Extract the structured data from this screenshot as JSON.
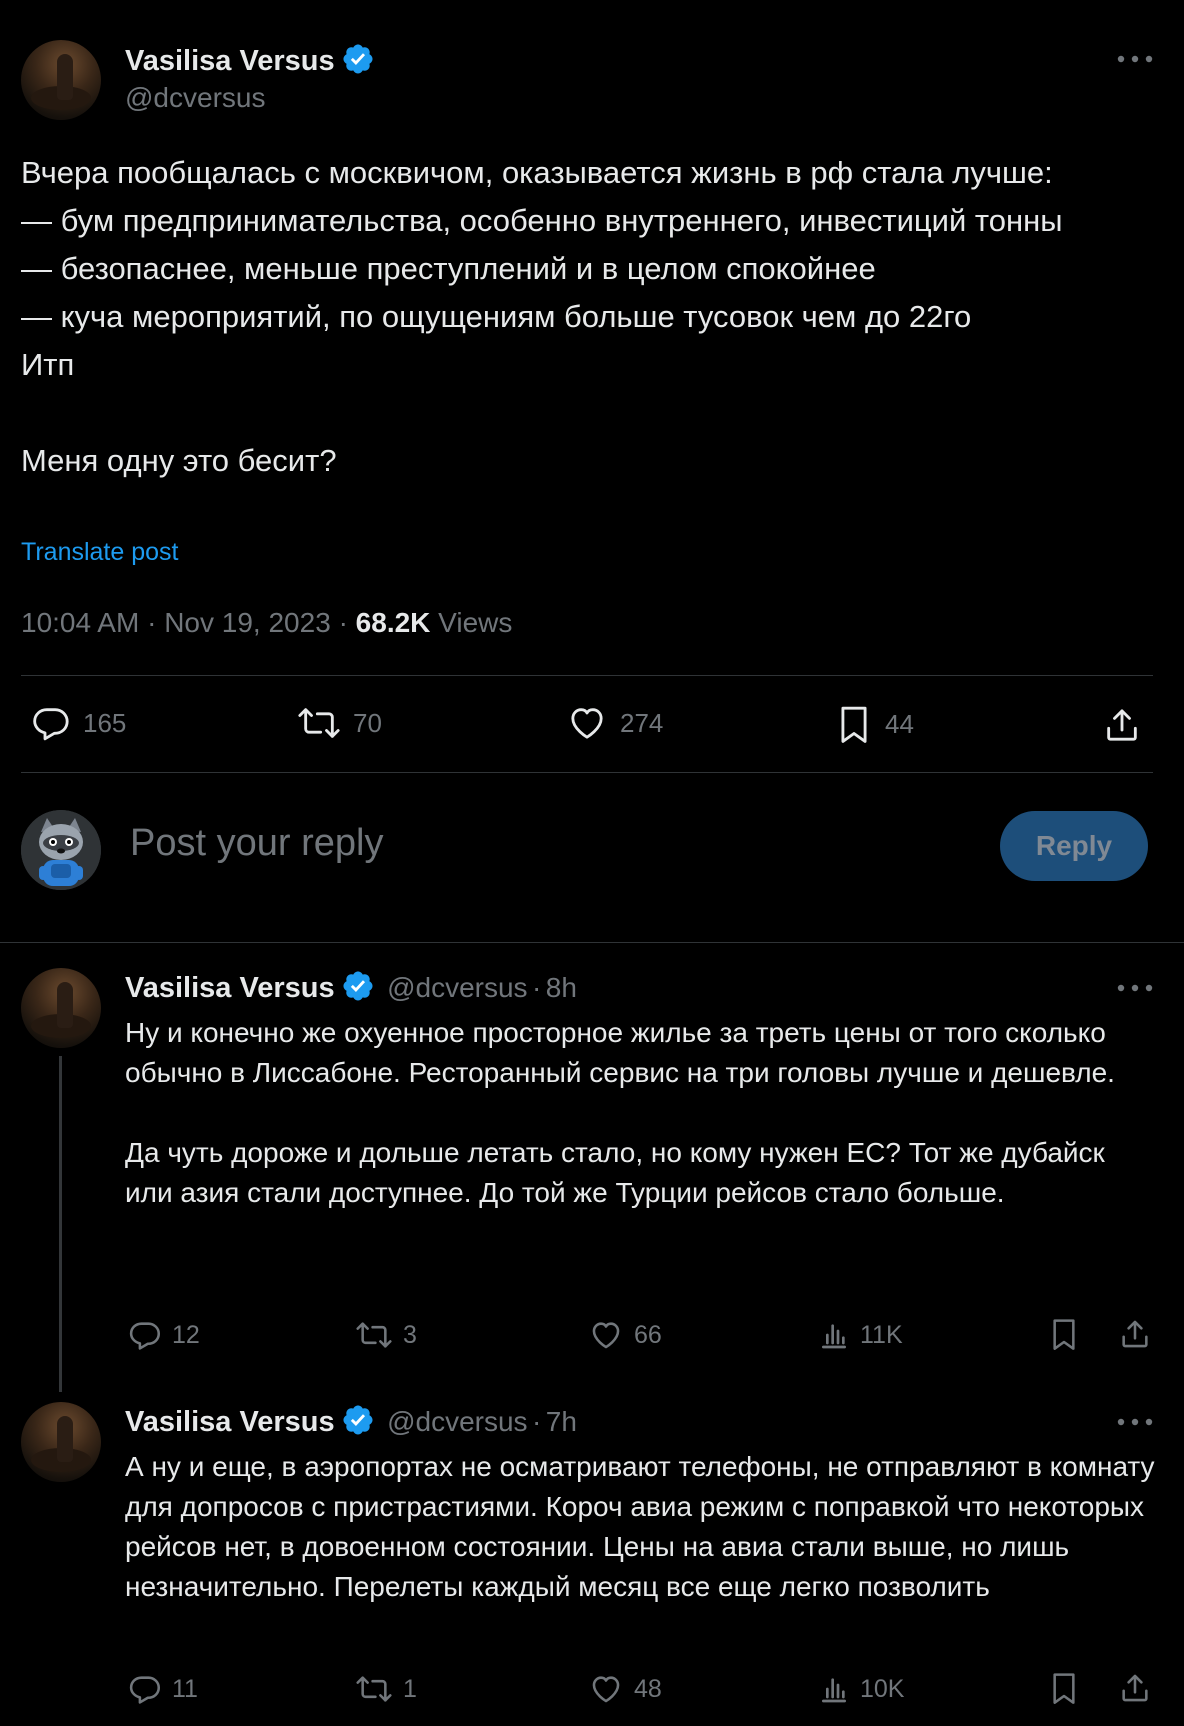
{
  "main_post": {
    "author_name": "Vasilisa Versus",
    "author_handle": "@dcversus",
    "text": "Вчера пообщалась с москвичом, оказывается жизнь в рф стала лучше:\n— бум предпринимательства, особенно внутреннего, инвестиций тонны\n— безопаснее, меньше преступлений и в целом спокойнее\n— куча мероприятий, по ощущениям больше тусовок чем до 22го\nИтп\n\nМеня одну это бесит?",
    "translate_label": "Translate post",
    "time": "10:04 AM",
    "dot": "·",
    "date": "Nov 19, 2023",
    "views_count": "68.2K",
    "views_label": "Views",
    "stats": {
      "replies": "165",
      "reposts": "70",
      "likes": "274",
      "bookmarks": "44"
    }
  },
  "composer": {
    "placeholder": "Post your reply",
    "button_label": "Reply"
  },
  "replies": [
    {
      "author_name": "Vasilisa Versus",
      "author_handle": "@dcversus",
      "dot": "·",
      "time": "8h",
      "text": "Ну и конечно же охуенное просторное жилье за треть цены от того сколько обычно в Лиссабоне. Ресторанный сервис на три головы лучше и дешевле.\n\nДа чуть дороже и дольше летать стало, но кому нужен ЕС? Тот же дубайск или азия стали доступнее. До той же Турции рейсов стало больше.",
      "replies": "12",
      "reposts": "3",
      "likes": "66",
      "views": "11K"
    },
    {
      "author_name": "Vasilisa Versus",
      "author_handle": "@dcversus",
      "dot": "·",
      "time": "7h",
      "text": "А ну и еще, в аэропортах не осматривают телефоны, не отправляют в комнату для допросов с пристрастиями. Короч авиа режим с поправкой что некоторых рейсов нет, в довоенном состоянии. Цены на авиа стали выше, но лишь незначительно. Перелеты каждый месяц все еще легко позволить",
      "replies": "11",
      "reposts": "1",
      "likes": "48",
      "views": "10K"
    }
  ],
  "colors": {
    "background": "#000000",
    "text": "#e7e9ea",
    "secondary": "#71767b",
    "accent": "#1d9bf0",
    "divider": "#2f3336"
  },
  "icons": [
    "verified-badge-icon",
    "more-icon",
    "reply-icon",
    "repost-icon",
    "like-icon",
    "bookmark-icon",
    "share-icon",
    "views-icon"
  ]
}
